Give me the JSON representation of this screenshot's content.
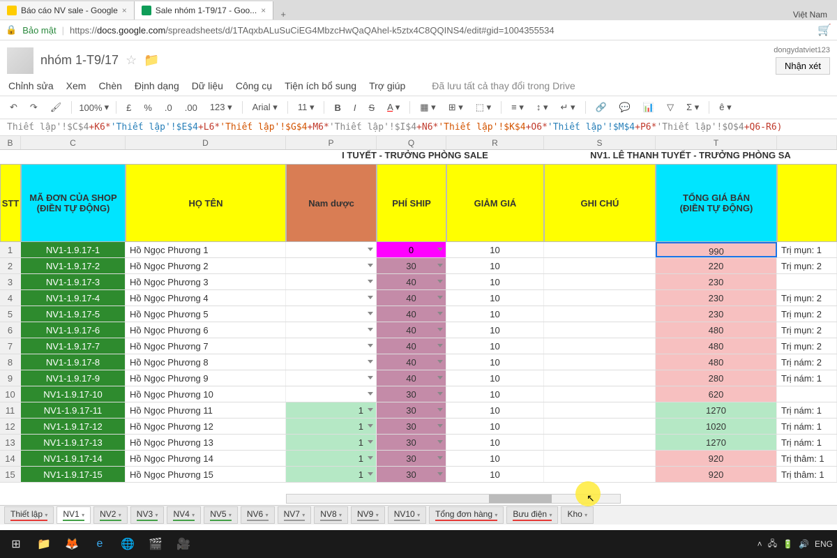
{
  "tabs": [
    {
      "label": "Báo cáo NV sale - Google",
      "favColor": "#ffcc00"
    },
    {
      "label": "Sale nhóm 1-T9/17 - Goo...",
      "favColor": "#0f9d58"
    }
  ],
  "lang": "Việt Nam",
  "secure": "Bảo mật",
  "url": {
    "prefix": "https://",
    "host": "docs.google.com",
    "path": "/spreadsheets/d/1TAqxbALuSuCiEG4MbzcHwQaQAhel-k5ztx4C8QQINS4/edit#gid=1004355534"
  },
  "doc": {
    "title": "nhóm 1-T9/17"
  },
  "user": "dongydatviet123",
  "commentBtn": "Nhận xét",
  "menus": [
    "Chỉnh sửa",
    "Xem",
    "Chèn",
    "Định dạng",
    "Dữ liệu",
    "Công cụ",
    "Tiện ích bổ sung",
    "Trợ giúp"
  ],
  "saved": "Đã lưu tất cả thay đổi trong Drive",
  "toolbar": {
    "zoom": "100%",
    "currency": "£",
    "pct": "%",
    "dec1": ".0",
    "dec2": ".00",
    "num": "123",
    "font": "Arial",
    "size": "11",
    "epsilon": "ê"
  },
  "formula": [
    {
      "t": "Thiết lập'!$C$4",
      "c": "seg3"
    },
    {
      "t": "+K6*",
      "c": "op"
    },
    {
      "t": "'Thiết lập'!$E$4",
      "c": "seg2"
    },
    {
      "t": "+L6*",
      "c": "op"
    },
    {
      "t": "'Thiết lập'!$G$4",
      "c": "seg1"
    },
    {
      "t": "+M6*",
      "c": "op"
    },
    {
      "t": "'Thiết lập'!$I$4",
      "c": "seg3"
    },
    {
      "t": "+N6*",
      "c": "op"
    },
    {
      "t": "'Thiết lập'!$K$4",
      "c": "seg1"
    },
    {
      "t": "+O6*",
      "c": "op"
    },
    {
      "t": "'Thiết lập'!$M$4",
      "c": "seg2"
    },
    {
      "t": "+P6*",
      "c": "op"
    },
    {
      "t": "'Thiết lập'!$O$4",
      "c": "seg3"
    },
    {
      "t": "+Q6-R6)",
      "c": "op"
    }
  ],
  "cols": [
    "B",
    "C",
    "D",
    "P",
    "Q",
    "R",
    "S",
    "T"
  ],
  "sectionM": "I TUYẾT - TRƯỞNG PHÒNG SALE",
  "sectionR": "NV1. LÊ THANH TUYẾT - TRƯỞNG PHÒNG SA",
  "headers": {
    "B": "STT",
    "C": "MÃ ĐƠN CỦA SHOP\n(ĐIỀN TỰ ĐỘNG)",
    "D": "HỌ TÊN",
    "P": "Nam dược",
    "Q": "PHÍ SHIP",
    "R": "GIẢM GIÁ",
    "S": "GHI CHÚ",
    "T": "TỔNG GIÁ BÁN\n(ĐIỀN TỰ ĐỘNG)"
  },
  "rows": [
    {
      "n": 1,
      "code": "NV1-1.9.17-1",
      "name": "Hồ Ngọc Phương 1",
      "p": "",
      "q": "0",
      "qcls": "q0",
      "r": "10",
      "t": "990",
      "tcls": "tp tsel",
      "u": "Trị mụn: 1"
    },
    {
      "n": 2,
      "code": "NV1-1.9.17-2",
      "name": "Hồ Ngọc Phương 2",
      "p": "",
      "q": "30",
      "qcls": "qx",
      "r": "10",
      "t": "220",
      "tcls": "tp",
      "u": "Trị mụn: 2"
    },
    {
      "n": 3,
      "code": "NV1-1.9.17-3",
      "name": "Hồ Ngọc Phương 3",
      "p": "",
      "q": "40",
      "qcls": "qx",
      "r": "10",
      "t": "230",
      "tcls": "tp",
      "u": ""
    },
    {
      "n": 4,
      "code": "NV1-1.9.17-4",
      "name": "Hồ Ngọc Phương 4",
      "p": "",
      "q": "40",
      "qcls": "qx",
      "r": "10",
      "t": "230",
      "tcls": "tp",
      "u": "Trị mụn: 2"
    },
    {
      "n": 5,
      "code": "NV1-1.9.17-5",
      "name": "Hồ Ngọc Phương 5",
      "p": "",
      "q": "40",
      "qcls": "qx",
      "r": "10",
      "t": "230",
      "tcls": "tp",
      "u": "Trị mụn: 2"
    },
    {
      "n": 6,
      "code": "NV1-1.9.17-6",
      "name": "Hồ Ngọc Phương 6",
      "p": "",
      "q": "40",
      "qcls": "qx",
      "r": "10",
      "t": "480",
      "tcls": "tp",
      "u": "Trị mụn: 2"
    },
    {
      "n": 7,
      "code": "NV1-1.9.17-7",
      "name": "Hồ Ngọc Phương 7",
      "p": "",
      "q": "40",
      "qcls": "qx",
      "r": "10",
      "t": "480",
      "tcls": "tp",
      "u": "Trị mụn: 2"
    },
    {
      "n": 8,
      "code": "NV1-1.9.17-8",
      "name": "Hồ Ngọc Phương 8",
      "p": "",
      "q": "40",
      "qcls": "qx",
      "r": "10",
      "t": "480",
      "tcls": "tp",
      "u": "Trị nám: 2"
    },
    {
      "n": 9,
      "code": "NV1-1.9.17-9",
      "name": "Hồ Ngọc Phương 9",
      "p": "",
      "q": "40",
      "qcls": "qx",
      "r": "10",
      "t": "280",
      "tcls": "tp",
      "u": "Trị nám: 1"
    },
    {
      "n": 10,
      "code": "NV1-1.9.17-10",
      "name": "Hồ Ngọc Phương 10",
      "p": "",
      "q": "30",
      "qcls": "qx",
      "r": "10",
      "t": "620",
      "tcls": "tp",
      "u": ""
    },
    {
      "n": 11,
      "code": "NV1-1.9.17-11",
      "name": "Hồ Ngọc Phương 11",
      "p": "1",
      "pcls": "pg",
      "q": "30",
      "qcls": "qx",
      "r": "10",
      "t": "1270",
      "tcls": "tg",
      "u": "Trị nám: 1"
    },
    {
      "n": 12,
      "code": "NV1-1.9.17-12",
      "name": "Hồ Ngọc Phương 12",
      "p": "1",
      "pcls": "pg",
      "q": "30",
      "qcls": "qx",
      "r": "10",
      "t": "1020",
      "tcls": "tg",
      "u": "Trị nám: 1"
    },
    {
      "n": 13,
      "code": "NV1-1.9.17-13",
      "name": "Hồ Ngọc Phương 13",
      "p": "1",
      "pcls": "pg",
      "q": "30",
      "qcls": "qx",
      "r": "10",
      "t": "1270",
      "tcls": "tg",
      "u": "Trị nám: 1"
    },
    {
      "n": 14,
      "code": "NV1-1.9.17-14",
      "name": "Hồ Ngọc Phương 14",
      "p": "1",
      "pcls": "pg",
      "q": "30",
      "qcls": "qx",
      "r": "10",
      "t": "920",
      "tcls": "tp",
      "u": "Trị thâm: 1"
    },
    {
      "n": 15,
      "code": "NV1-1.9.17-15",
      "name": "Hồ Ngọc Phương 15",
      "p": "1",
      "pcls": "pg",
      "q": "30",
      "qcls": "qx",
      "r": "10",
      "t": "920",
      "tcls": "tp",
      "u": "Trị thâm: 1"
    }
  ],
  "sheetTabs": [
    {
      "label": "Thiết lập",
      "u": "u-red"
    },
    {
      "label": "NV1",
      "u": "u-grn",
      "active": true
    },
    {
      "label": "NV2",
      "u": "u-grn"
    },
    {
      "label": "NV3",
      "u": "u-grn"
    },
    {
      "label": "NV4",
      "u": "u-grn"
    },
    {
      "label": "NV5",
      "u": "u-grn"
    },
    {
      "label": "NV6",
      "u": "u-gry"
    },
    {
      "label": "NV7",
      "u": "u-gry"
    },
    {
      "label": "NV8",
      "u": "u-gry"
    },
    {
      "label": "NV9",
      "u": "u-gry"
    },
    {
      "label": "NV10",
      "u": "u-gry"
    },
    {
      "label": "Tổng đơn hàng",
      "u": "u-red"
    },
    {
      "label": "Bưu điện",
      "u": "u-red"
    },
    {
      "label": "Kho",
      "u": ""
    }
  ],
  "tray": {
    "lang": "ENG"
  }
}
